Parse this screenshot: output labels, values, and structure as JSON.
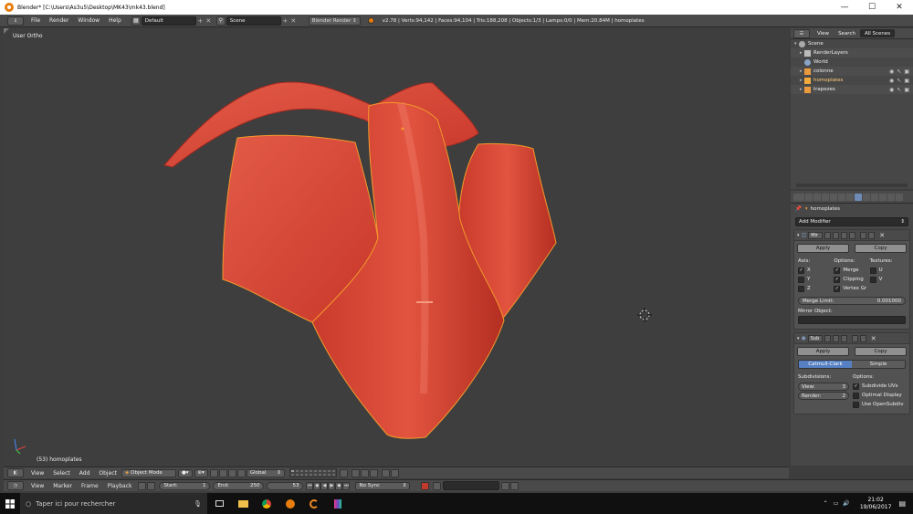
{
  "window": {
    "title": "Blender* [C:\\Users\\As3u5\\Desktop\\MK43\\mk43.blend]",
    "minimize": "—",
    "maximize": "☐",
    "close": "✕"
  },
  "info_header": {
    "menus": [
      "File",
      "Render",
      "Window",
      "Help"
    ],
    "layout": "Default",
    "scene": "Scene",
    "engine": "Blender Render",
    "stats": "v2.78 | Verts:94,142 | Faces:94,104 | Tris:188,208 | Objects:1/3 | Lamps:0/0 | Mem:20.84M | homoplates"
  },
  "viewport": {
    "view_label": "User Ortho",
    "object_label": "(53) homoplates"
  },
  "viewport_header": {
    "menus": [
      "View",
      "Select",
      "Add",
      "Object"
    ],
    "mode": "Object Mode",
    "orientation": "Global"
  },
  "timeline_header": {
    "menus": [
      "View",
      "Marker",
      "Frame",
      "Playback"
    ],
    "start_label": "Start:",
    "start_value": "1",
    "end_label": "End:",
    "end_value": "250",
    "current_frame": "53",
    "sync": "No Sync"
  },
  "outliner": {
    "tabs": [
      "View",
      "Search",
      "All Scenes"
    ],
    "rows": [
      {
        "label": "Scene",
        "indent": 0
      },
      {
        "label": "RenderLayers",
        "indent": 1
      },
      {
        "label": "World",
        "indent": 1
      },
      {
        "label": "colonne",
        "indent": 1
      },
      {
        "label": "homoplates",
        "indent": 1
      },
      {
        "label": "trapezes",
        "indent": 1
      }
    ]
  },
  "properties": {
    "object_name": "homoplates",
    "add_modifier": "Add Modifier",
    "mirror": {
      "name": "Mir",
      "apply": "Apply",
      "copy": "Copy",
      "axis_label": "Axis:",
      "options_label": "Options:",
      "textures_label": "Textures:",
      "axis": [
        "X",
        "Y",
        "Z"
      ],
      "options": [
        "Merge",
        "Clipping",
        "Vertex Gr"
      ],
      "textures": [
        "U",
        "V"
      ],
      "merge_limit_label": "Merge Limit:",
      "merge_limit_value": "0.001000",
      "mirror_object_label": "Mirror Object:"
    },
    "subsurf": {
      "name": "Sub",
      "apply": "Apply",
      "copy": "Copy",
      "catmull": "Catmull-Clark",
      "simple": "Simple",
      "subdivisions_label": "Subdivisions:",
      "options_label": "Options:",
      "view_label": "View:",
      "view_value": "3",
      "render_label": "Render:",
      "render_value": "2",
      "opt_uvs": "Subdivide UVs",
      "opt_display": "Optimal Display",
      "opt_opensubdiv": "Use OpenSubdiv"
    }
  },
  "taskbar": {
    "search_placeholder": "Taper ici pour rechercher",
    "time": "21:02",
    "date": "19/06/2017"
  },
  "colors": {
    "accent": "#5680c2",
    "mesh": "#d8493a",
    "selection_outline": "#f39a2b"
  }
}
